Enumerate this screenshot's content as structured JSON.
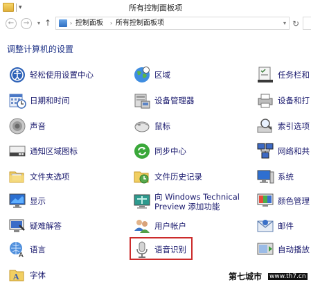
{
  "window": {
    "title": "所有控制面板项"
  },
  "address": {
    "crumb1": "控制面板",
    "crumb2": "所有控制面板项",
    "separator": "›"
  },
  "nav": {
    "back": "←",
    "forward": "→",
    "dropdown": "▾",
    "up": "↑",
    "refresh": "↻"
  },
  "heading": "调整计算机的设置",
  "items": {
    "c1": [
      "轻松使用设置中心",
      "日期和时间",
      "声音",
      "通知区域图标",
      "文件夹选项",
      "显示",
      "疑难解答",
      "语言",
      "字体"
    ],
    "c2": [
      "区域",
      "设备管理器",
      "鼠标",
      "同步中心",
      "文件历史记录",
      "向 Windows Technical",
      "Preview 添加功能",
      "用户帐户",
      "语音识别"
    ],
    "c3": [
      "任务栏和",
      "设备和打",
      "索引选项",
      "网络和共",
      "系统",
      "颜色管理",
      "邮件",
      "自动播放"
    ]
  },
  "watermark": {
    "text": "第七城市",
    "url": "www.th7.cn"
  },
  "highlight_color": "#cc2b2b"
}
